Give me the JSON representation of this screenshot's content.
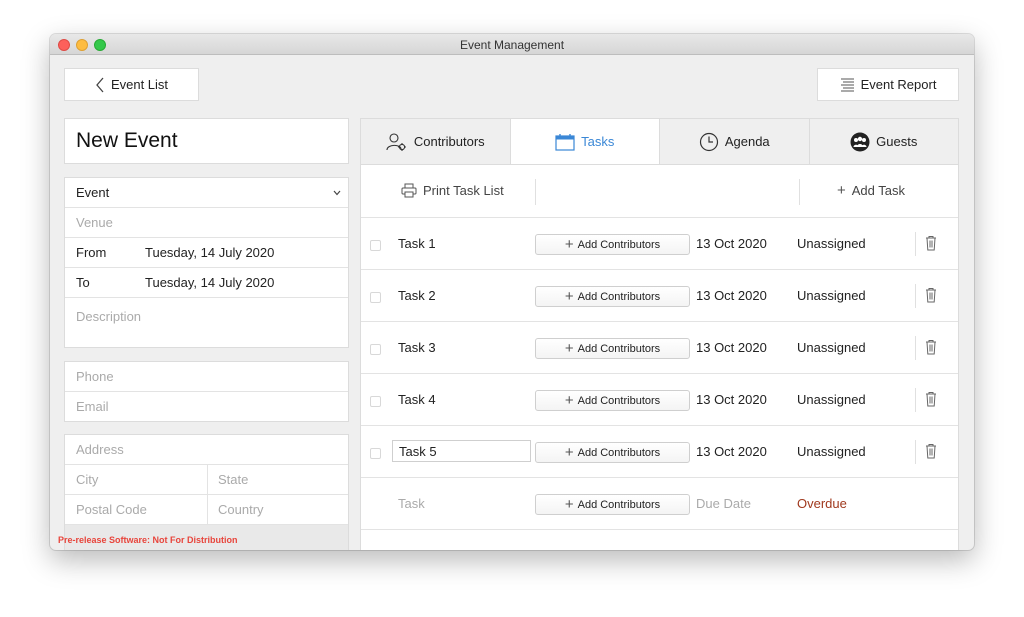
{
  "window": {
    "title": "Event Management"
  },
  "nav": {
    "back_label": "Event List",
    "report_label": "Event Report"
  },
  "event": {
    "title": "New Event",
    "type_value": "Event",
    "venue_placeholder": "Venue",
    "from_label": "From",
    "from_value": "Tuesday, 14 July 2020",
    "to_label": "To",
    "to_value": "Tuesday, 14 July 2020",
    "description_placeholder": "Description"
  },
  "contact": {
    "phone_placeholder": "Phone",
    "email_placeholder": "Email"
  },
  "address": {
    "address_placeholder": "Address",
    "city_placeholder": "City",
    "state_placeholder": "State",
    "postal_placeholder": "Postal Code",
    "country_placeholder": "Country"
  },
  "tabs": [
    {
      "label": "Contributors",
      "icon": "contributors-icon"
    },
    {
      "label": "Tasks",
      "icon": "calendar-icon",
      "active": true
    },
    {
      "label": "Agenda",
      "icon": "clock-icon"
    },
    {
      "label": "Guests",
      "icon": "guests-icon"
    }
  ],
  "toolbar": {
    "print_label": "Print Task List",
    "add_label": "Add Task"
  },
  "tasks": [
    {
      "name": "Task 1",
      "add_label": "Add Contributors",
      "due": "13 Oct 2020",
      "status": "Unassigned"
    },
    {
      "name": "Task 2",
      "add_label": "Add Contributors",
      "due": "13 Oct 2020",
      "status": "Unassigned"
    },
    {
      "name": "Task 3",
      "add_label": "Add Contributors",
      "due": "13 Oct 2020",
      "status": "Unassigned"
    },
    {
      "name": "Task 4",
      "add_label": "Add Contributors",
      "due": "13 Oct 2020",
      "status": "Unassigned"
    },
    {
      "name": "Task 5",
      "add_label": "Add Contributors",
      "due": "13 Oct 2020",
      "status": "Unassigned"
    }
  ],
  "new_task": {
    "name_placeholder": "Task",
    "add_label": "Add Contributors",
    "due_placeholder": "Due Date",
    "status": "Overdue"
  },
  "colors": {
    "accent": "#3a87d6",
    "overdue": "#a0391e",
    "watermark": "#e8453c"
  },
  "watermark": "Pre-release Software: Not For Distribution"
}
